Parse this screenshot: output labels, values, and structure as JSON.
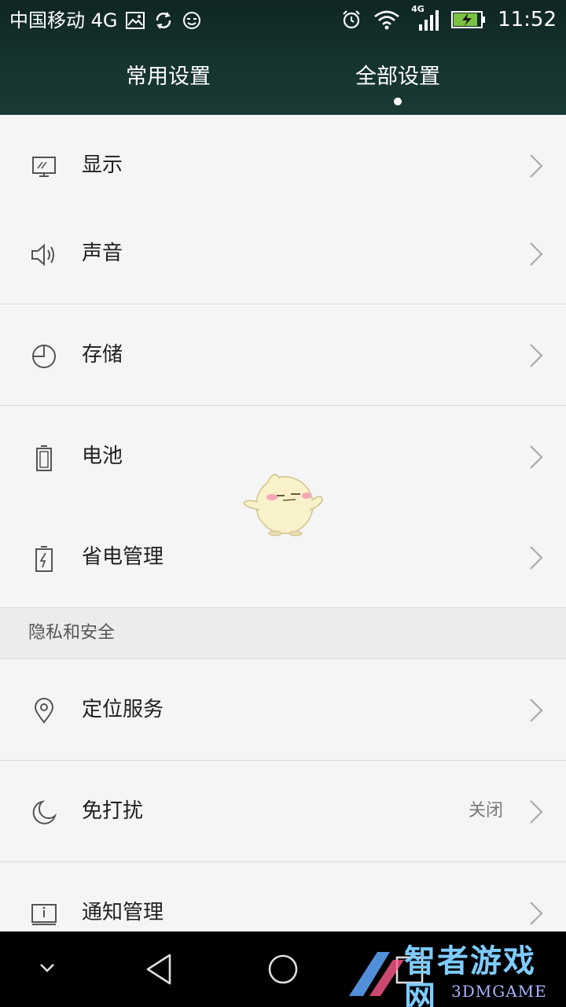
{
  "status_bar": {
    "carrier": "中国移动 4G",
    "time": "11:52",
    "network_badge": "4G",
    "icons": [
      "image-icon",
      "sync-icon",
      "face-icon",
      "alarm-icon",
      "wifi-icon",
      "signal-icon",
      "battery-charging-icon"
    ]
  },
  "tabs": [
    {
      "label": "常用设置",
      "active": false
    },
    {
      "label": "全部设置",
      "active": true
    }
  ],
  "items": [
    {
      "label": "显示",
      "icon": "display-icon"
    },
    {
      "label": "声音",
      "icon": "speaker-icon"
    },
    {
      "label": "存储",
      "icon": "storage-pie-icon"
    },
    {
      "label": "电池",
      "icon": "battery-icon"
    },
    {
      "label": "省电管理",
      "icon": "power-saving-icon"
    }
  ],
  "section": {
    "title": "隐私和安全"
  },
  "privacy_items": [
    {
      "label": "定位服务",
      "icon": "location-icon",
      "value": ""
    },
    {
      "label": "免打扰",
      "icon": "moon-icon",
      "value": "关闭"
    },
    {
      "label": "通知管理",
      "icon": "notification-icon",
      "value": ""
    }
  ],
  "nav": {
    "buttons": [
      "down-icon",
      "back-icon",
      "home-icon",
      "recents-icon"
    ]
  },
  "watermark": {
    "main": "智者游戏网",
    "sub": "3DMGAME"
  },
  "colors": {
    "header": "#16332f",
    "background": "#f5f5f5",
    "watermark": "#7ecbff"
  }
}
